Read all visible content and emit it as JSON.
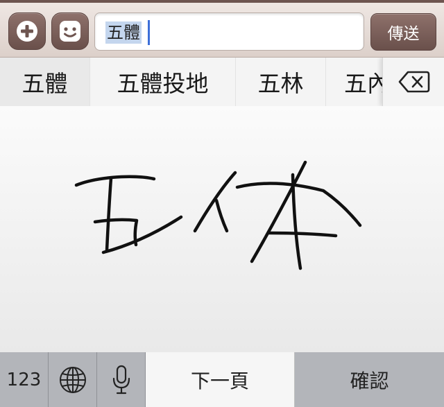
{
  "toolbar": {
    "input_value": "五體",
    "send_label": "傳送"
  },
  "icons": {
    "add": "plus-icon",
    "emoji": "smiley-icon",
    "delete": "backspace-icon",
    "globe": "globe-icon",
    "mic": "microphone-icon"
  },
  "candidates": [
    {
      "label": "五體"
    },
    {
      "label": "五體投地"
    },
    {
      "label": "五林"
    },
    {
      "label": "五內"
    }
  ],
  "keyboard": {
    "numbers_label": "123",
    "next_page_label": "下一頁",
    "confirm_label": "確認"
  },
  "colors": {
    "toolbar_accent": "#7a5e58",
    "selection": "#c4d6ee",
    "caret": "#3d6fd8",
    "ink": "#111111"
  }
}
